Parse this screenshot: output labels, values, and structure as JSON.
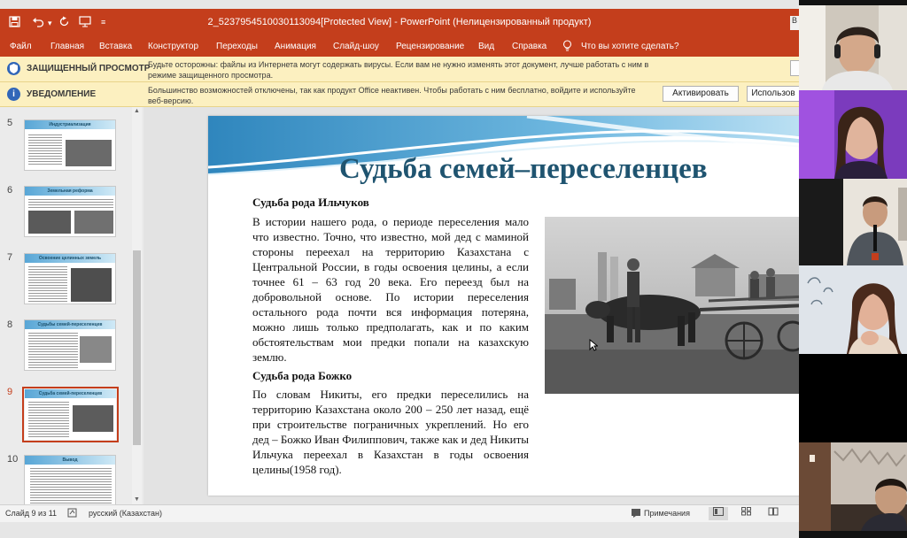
{
  "window": {
    "title": "2_5237954510030113094[Protected View]  -  PowerPoint (Нелицензированный продукт)",
    "account_initial": "В"
  },
  "quick_access": {
    "save_icon": "save-icon",
    "undo_icon": "undo-icon",
    "redo_icon": "redo-icon",
    "customize_icon": "customize-icon"
  },
  "ribbon": {
    "tabs": [
      "Файл",
      "Главная",
      "Вставка",
      "Конструктор",
      "Переходы",
      "Анимация",
      "Слайд-шоу",
      "Рецензирование",
      "Вид",
      "Справка"
    ],
    "tell_me": "Что вы хотите сделать?"
  },
  "protected_bar": {
    "label": "ЗАЩИЩЕННЫЙ ПРОСМОТР",
    "text": "Будьте осторожны: файлы из Интернета могут содержать вирусы. Если вам не нужно изменять этот документ, лучше работать с ним в режиме защищенного просмотра."
  },
  "notice_bar": {
    "label": "УВЕДОМЛЕНИЕ",
    "text": "Большинство возможностей отключены, так как продукт Office неактивен. Чтобы работать с ним бесплатно, войдите и используйте веб-версию.",
    "activate_button": "Активировать",
    "use_button": "Использов"
  },
  "thumbnails": [
    {
      "number": "5",
      "title": "Индустриализация"
    },
    {
      "number": "6",
      "title": "Земельная реформа"
    },
    {
      "number": "7",
      "title": "Освоение целинных земель"
    },
    {
      "number": "8",
      "title": "Судьбы семей-переселенцев"
    },
    {
      "number": "9",
      "title": "Судьба семей-переселенцев",
      "selected": true
    },
    {
      "number": "10",
      "title": "Вывод"
    }
  ],
  "slide": {
    "title": "Судьба семей–переселенцев",
    "heading1": "Судьба рода Ильчуков",
    "paragraph1": "В истории нашего рода, о периоде переселения мало что известно. Точно, что известно, мой дед с маминой стороны переехал на территорию Казахстана с Центральной России, в годы освоения целины, а если точнее 61 – 63 год 20 века. Его переезд был на добровольной основе. По истории переселения остального рода почти вся информация потеряна, можно лишь только предполагать, как и по каким обстоятельствам мои предки попали на казахскую землю.",
    "heading2": "Судьба рода Божко",
    "paragraph2": "По словам Никиты, его предки переселились на территорию Казахстана около 200 – 250 лет назад, ещё при строительстве пограничных укреплений. Но его дед – Божко Иван Филиппович, также как и дед Никиты Ильчука переехал в Казахстан в годы освоения целины(1958 год)."
  },
  "status_bar": {
    "slide_info": "Слайд 9 из 11",
    "language": "русский (Казахстан)",
    "notes": "Примечания"
  },
  "colors": {
    "accent": "#c43e1c",
    "message_bar": "#fcf0c0",
    "title_text": "#1f5470"
  }
}
